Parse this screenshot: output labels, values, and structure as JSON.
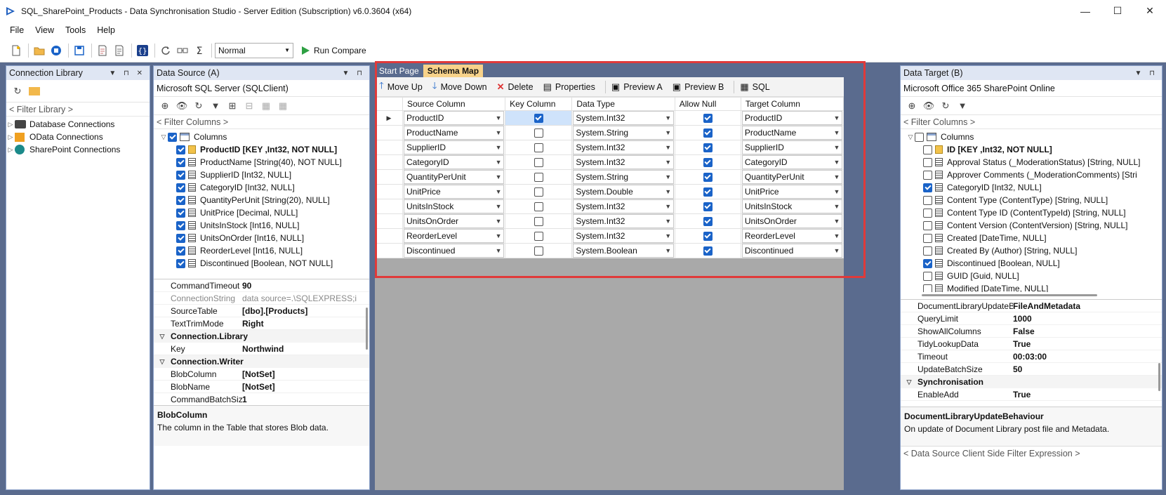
{
  "window": {
    "title": "SQL_SharePoint_Products - Data Synchronisation Studio - Server Edition (Subscription) v6.0.3604 (x64)",
    "minimize": "—",
    "maximize": "☐",
    "close": "✕"
  },
  "menu": [
    "File",
    "View",
    "Tools",
    "Help"
  ],
  "toolbar": {
    "mode": "Normal",
    "run_compare": "Run Compare"
  },
  "connection_library": {
    "title": "Connection Library",
    "filter": "< Filter Library >",
    "items": [
      "Database Connections",
      "OData Connections",
      "SharePoint Connections"
    ]
  },
  "data_source": {
    "title": "Data Source (A)",
    "provider": "Microsoft SQL Server (SQLClient)",
    "filter": "< Filter Columns >",
    "root": "Columns",
    "columns": [
      {
        "label": "ProductID [KEY ,Int32, NOT NULL]",
        "key": true
      },
      {
        "label": "ProductName [String(40), NOT NULL]",
        "key": false
      },
      {
        "label": "SupplierID [Int32, NULL]",
        "key": false
      },
      {
        "label": "CategoryID [Int32, NULL]",
        "key": false
      },
      {
        "label": "QuantityPerUnit [String(20), NULL]",
        "key": false
      },
      {
        "label": "UnitPrice [Decimal, NULL]",
        "key": false
      },
      {
        "label": "UnitsInStock [Int16, NULL]",
        "key": false
      },
      {
        "label": "UnitsOnOrder [Int16, NULL]",
        "key": false
      },
      {
        "label": "ReorderLevel [Int16, NULL]",
        "key": false
      },
      {
        "label": "Discontinued [Boolean, NOT NULL]",
        "key": false
      }
    ],
    "props": [
      {
        "type": "row",
        "name": "CommandTimeout",
        "value": "90"
      },
      {
        "type": "row",
        "name": "ConnectionString",
        "value": "data source=.\\SQLEXPRESS;i",
        "dim": true
      },
      {
        "type": "row",
        "name": "SourceTable",
        "value": "[dbo].[Products]"
      },
      {
        "type": "row",
        "name": "TextTrimMode",
        "value": "Right"
      },
      {
        "type": "cat",
        "name": "Connection.Library"
      },
      {
        "type": "row",
        "name": "Key",
        "value": "Northwind"
      },
      {
        "type": "cat",
        "name": "Connection.Writer"
      },
      {
        "type": "row",
        "name": "BlobColumn",
        "value": "[NotSet]"
      },
      {
        "type": "row",
        "name": "BlobName",
        "value": "[NotSet]"
      },
      {
        "type": "row",
        "name": "CommandBatchSize",
        "value": "1"
      }
    ],
    "desc_title": "BlobColumn",
    "desc_text": "The column in the Table that stores Blob data."
  },
  "schema_map": {
    "tabs": [
      "Start Page",
      "Schema Map"
    ],
    "actions": [
      "Move Up",
      "Move Down",
      "Delete",
      "Properties",
      "Preview A",
      "Preview B",
      "SQL"
    ],
    "headers": [
      "Source Column",
      "Key Column",
      "Data Type",
      "Allow Null",
      "Target Column"
    ],
    "rows": [
      {
        "source": "ProductID",
        "key": true,
        "type": "System.Int32",
        "null": true,
        "target": "ProductID"
      },
      {
        "source": "ProductName",
        "key": false,
        "type": "System.String",
        "null": true,
        "target": "ProductName"
      },
      {
        "source": "SupplierID",
        "key": false,
        "type": "System.Int32",
        "null": true,
        "target": "SupplierID"
      },
      {
        "source": "CategoryID",
        "key": false,
        "type": "System.Int32",
        "null": true,
        "target": "CategoryID"
      },
      {
        "source": "QuantityPerUnit",
        "key": false,
        "type": "System.String",
        "null": true,
        "target": "QuantityPerUnit"
      },
      {
        "source": "UnitPrice",
        "key": false,
        "type": "System.Double",
        "null": true,
        "target": "UnitPrice"
      },
      {
        "source": "UnitsInStock",
        "key": false,
        "type": "System.Int32",
        "null": true,
        "target": "UnitsInStock"
      },
      {
        "source": "UnitsOnOrder",
        "key": false,
        "type": "System.Int32",
        "null": true,
        "target": "UnitsOnOrder"
      },
      {
        "source": "ReorderLevel",
        "key": false,
        "type": "System.Int32",
        "null": true,
        "target": "ReorderLevel"
      },
      {
        "source": "Discontinued",
        "key": false,
        "type": "System.Boolean",
        "null": true,
        "target": "Discontinued"
      }
    ]
  },
  "data_target": {
    "title": "Data Target (B)",
    "provider": "Microsoft Office 365 SharePoint Online",
    "filter": "< Filter Columns >",
    "root": "Columns",
    "columns": [
      {
        "label": "ID [KEY ,Int32, NOT NULL]",
        "key": true,
        "checked": false
      },
      {
        "label": "Approval Status (_ModerationStatus) [String, NULL]",
        "key": false,
        "checked": false
      },
      {
        "label": "Approver Comments (_ModerationComments) [Stri",
        "key": false,
        "checked": false
      },
      {
        "label": "CategoryID [Int32, NULL]",
        "key": false,
        "checked": true
      },
      {
        "label": "Content Type (ContentType) [String, NULL]",
        "key": false,
        "checked": false
      },
      {
        "label": "Content Type ID (ContentTypeId) [String, NULL]",
        "key": false,
        "checked": false
      },
      {
        "label": "Content Version (ContentVersion) [String, NULL]",
        "key": false,
        "checked": false
      },
      {
        "label": "Created [DateTime, NULL]",
        "key": false,
        "checked": false
      },
      {
        "label": "Created By (Author) [String, NULL]",
        "key": false,
        "checked": false
      },
      {
        "label": "Discontinued [Boolean, NULL]",
        "key": false,
        "checked": true
      },
      {
        "label": "GUID [Guid, NULL]",
        "key": false,
        "checked": false
      },
      {
        "label": "Modified [DateTime, NULL]",
        "key": false,
        "checked": false
      }
    ],
    "props": [
      {
        "type": "row",
        "name": "DocumentLibraryUpdateBe",
        "value": "FileAndMetadata"
      },
      {
        "type": "row",
        "name": "QueryLimit",
        "value": "1000"
      },
      {
        "type": "row",
        "name": "ShowAllColumns",
        "value": "False"
      },
      {
        "type": "row",
        "name": "TidyLookupData",
        "value": "True"
      },
      {
        "type": "row",
        "name": "Timeout",
        "value": "00:03:00"
      },
      {
        "type": "row",
        "name": "UpdateBatchSize",
        "value": "50"
      },
      {
        "type": "cat",
        "name": "Synchronisation"
      },
      {
        "type": "row",
        "name": "EnableAdd",
        "value": "True"
      }
    ],
    "desc_title": "DocumentLibraryUpdateBehaviour",
    "desc_text": "On update of Document Library post file and Metadata.",
    "footer_filter": "< Data Source Client Side Filter Expression >"
  }
}
